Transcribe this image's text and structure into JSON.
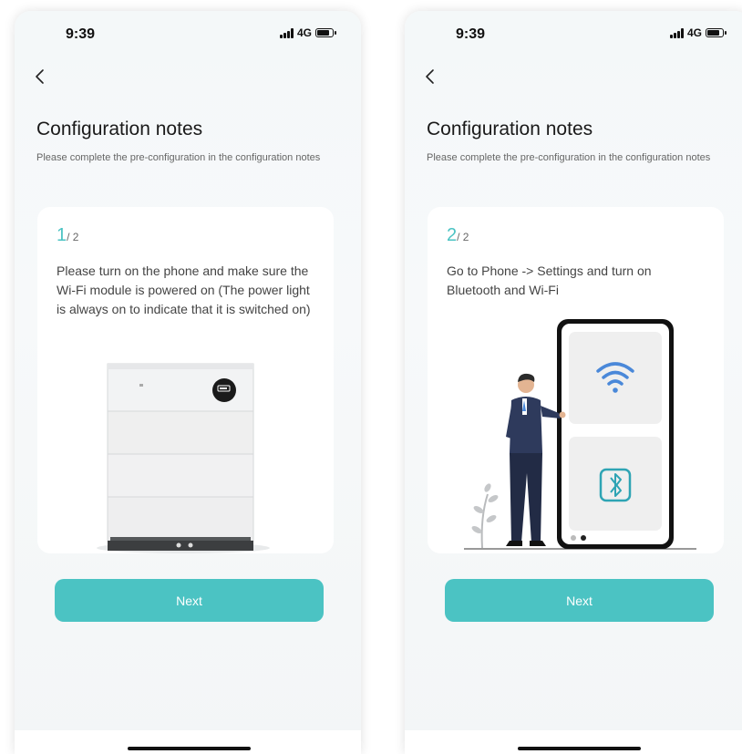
{
  "status": {
    "time": "9:39",
    "network": "4G"
  },
  "page": {
    "title": "Configuration notes",
    "subtitle": "Please complete the pre-configuration in the configuration notes"
  },
  "screens": [
    {
      "step_current": "1",
      "step_total": "/ 2",
      "description": "Please turn on the phone and make sure the Wi-Fi module is powered on (The power light is always on to indicate that it is switched on)",
      "next_label": "Next"
    },
    {
      "step_current": "2",
      "step_total": "/ 2",
      "description": "Go to Phone -> Settings and turn on Bluetooth and Wi-Fi",
      "next_label": "Next"
    }
  ],
  "icons": [
    "chevron-left-icon",
    "signal-icon",
    "battery-icon",
    "wifi-icon",
    "bluetooth-icon"
  ],
  "colors": {
    "accent": "#4bc3c3",
    "text_dark": "#1a1a1a",
    "text_body": "#444444",
    "text_muted": "#666666"
  }
}
